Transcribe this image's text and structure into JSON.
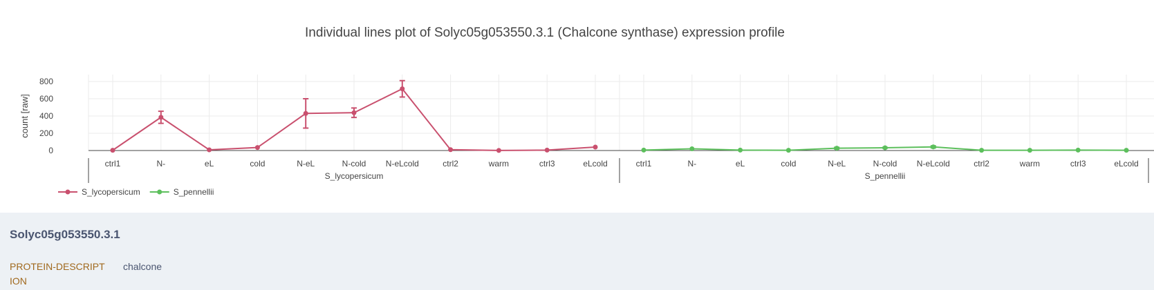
{
  "chart_data": {
    "type": "line",
    "title": "Individual lines plot of Solyc05g053550.3.1 (Chalcone synthase) expression profile",
    "ylabel": "count [raw]",
    "xlabel": "",
    "ylim": [
      0,
      880
    ],
    "yticks": [
      0,
      200,
      400,
      600,
      800
    ],
    "grid": true,
    "legend": "bottom-left",
    "groups": [
      {
        "name": "S_lycopersicum",
        "categories": [
          "ctrl1",
          "N-",
          "eL",
          "cold",
          "N-eL",
          "N-cold",
          "N-eLcold",
          "ctrl2",
          "warm",
          "ctrl3",
          "eLcold"
        ]
      },
      {
        "name": "S_pennellii",
        "categories": [
          "ctrl1",
          "N-",
          "eL",
          "cold",
          "N-eL",
          "N-cold",
          "N-eLcold",
          "ctrl2",
          "warm",
          "ctrl3",
          "eLcold"
        ]
      }
    ],
    "series": [
      {
        "name": "S_lycopersicum",
        "color": "#c9506e",
        "group": 0,
        "values": [
          3,
          385,
          8,
          35,
          430,
          438,
          715,
          10,
          1,
          5,
          40
        ],
        "errors": [
          0,
          70,
          0,
          0,
          170,
          55,
          95,
          0,
          0,
          0,
          0
        ]
      },
      {
        "name": "S_pennellii",
        "color": "#5cbf5c",
        "group": 1,
        "values": [
          5,
          20,
          5,
          3,
          27,
          32,
          42,
          3,
          3,
          5,
          3
        ],
        "errors": [
          0,
          0,
          0,
          0,
          10,
          5,
          12,
          0,
          0,
          0,
          0
        ]
      }
    ]
  },
  "info": {
    "gene_id": "Solyc05g053550.3.1",
    "key": "PROTEIN-DESCRIPTION",
    "value": "chalcone"
  }
}
